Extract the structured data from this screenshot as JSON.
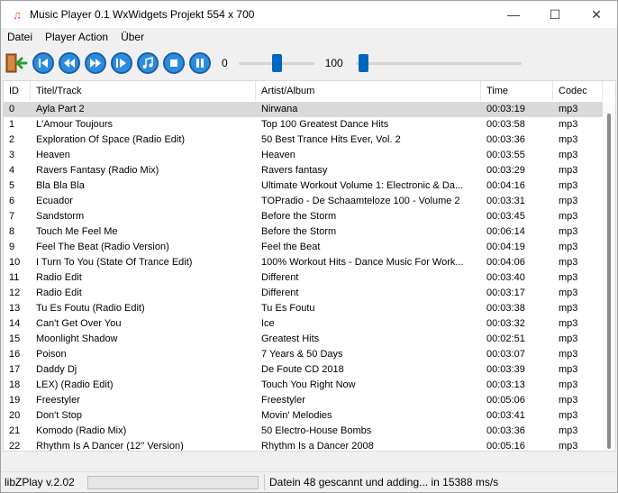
{
  "window": {
    "title": "Music Player 0.1 WxWidgets Projekt 554 x 700",
    "minimize_label": "—",
    "maximize_label": "☐",
    "close_label": "✕"
  },
  "menu": {
    "items": [
      "Datei",
      "Player Action",
      "Über"
    ]
  },
  "toolbar": {
    "buttons": [
      "exit-icon",
      "previous-icon",
      "rewind-icon",
      "fast-forward-icon",
      "next-icon",
      "music-note-icon",
      "stop-icon",
      "pause-icon"
    ],
    "position_label": "0",
    "position_value": 0.5,
    "volume_label": "100",
    "volume_value": 0.02,
    "accent_color": "#2c8de0"
  },
  "list": {
    "columns": [
      "ID",
      "Titel/Track",
      "Artist/Album",
      "Time",
      "Codec"
    ],
    "selected_index": 0,
    "rows": [
      [
        "0",
        "Ayla Part 2",
        "Nirwana",
        "00:03:19",
        "mp3"
      ],
      [
        "1",
        "L'Amour Toujours",
        "Top 100 Greatest Dance Hits",
        "00:03:58",
        "mp3"
      ],
      [
        "2",
        "Exploration Of Space (Radio Edit)",
        "50 Best Trance Hits Ever, Vol. 2",
        "00:03:36",
        "mp3"
      ],
      [
        "3",
        "Heaven",
        "Heaven",
        "00:03:55",
        "mp3"
      ],
      [
        "4",
        "Ravers Fantasy (Radio Mix)",
        "Ravers fantasy",
        "00:03:29",
        "mp3"
      ],
      [
        "5",
        "Bla Bla Bla",
        "Ultimate Workout Volume 1: Electronic & Da...",
        "00:04:16",
        "mp3"
      ],
      [
        "6",
        "Ecuador",
        "TOPradio - De Schaamteloze 100 - Volume 2",
        "00:03:31",
        "mp3"
      ],
      [
        "7",
        "Sandstorm",
        "Before the Storm",
        "00:03:45",
        "mp3"
      ],
      [
        "8",
        "Touch Me Feel Me",
        "Before the Storm",
        "00:06:14",
        "mp3"
      ],
      [
        "9",
        "Feel The Beat (Radio Version)",
        "Feel the Beat",
        "00:04:19",
        "mp3"
      ],
      [
        "10",
        "I Turn To You (State Of Trance Edit)",
        "100% Workout Hits - Dance Music For Work...",
        "00:04:06",
        "mp3"
      ],
      [
        "11",
        "Radio Edit",
        "Different",
        "00:03:40",
        "mp3"
      ],
      [
        "12",
        "Radio Edit",
        "Different",
        "00:03:17",
        "mp3"
      ],
      [
        "13",
        "Tu Es Foutu (Radio Edit)",
        "Tu Es Foutu",
        "00:03:38",
        "mp3"
      ],
      [
        "14",
        "Can't Get Over You",
        "Ice",
        "00:03:32",
        "mp3"
      ],
      [
        "15",
        "Moonlight Shadow",
        "Greatest Hits",
        "00:02:51",
        "mp3"
      ],
      [
        "16",
        "Poison",
        "7 Years & 50 Days",
        "00:03:07",
        "mp3"
      ],
      [
        "17",
        "Daddy Dj",
        "De Foute CD 2018",
        "00:03:39",
        "mp3"
      ],
      [
        "18",
        "LEX) (Radio Edit)",
        "Touch You Right Now",
        "00:03:13",
        "mp3"
      ],
      [
        "19",
        "Freestyler",
        "Freestyler",
        "00:05:06",
        "mp3"
      ],
      [
        "20",
        "Don't Stop",
        "Movin' Melodies",
        "00:03:41",
        "mp3"
      ],
      [
        "21",
        "Komodo (Radio Mix)",
        "50 Electro-House Bombs",
        "00:03:36",
        "mp3"
      ],
      [
        "22",
        "Rhythm Is A Dancer (12'' Version)",
        "Rhythm Is a Dancer 2008",
        "00:05:16",
        "mp3"
      ]
    ]
  },
  "status": {
    "version": "libZPlay v.2.02",
    "progress": 0,
    "message": "Datein 48 gescannt und adding... in 15388 ms/s"
  }
}
